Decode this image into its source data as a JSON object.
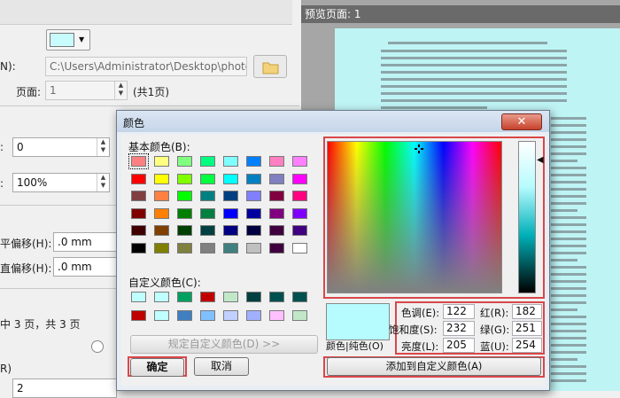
{
  "background": {
    "fields": [
      {
        "label": "N):",
        "value": "C:\\Users\\Administrator\\Desktop\\photo"
      },
      {
        "label": "页面:",
        "value": "1",
        "suffix": "(共1页)"
      },
      {
        "label": ":",
        "value": "0"
      },
      {
        "label": ":",
        "value": "100%"
      },
      {
        "label": "平偏移(H):",
        "value": ".0 mm"
      },
      {
        "label": "直偏移(H):",
        "value": ".0 mm"
      },
      {
        "label": "R)",
        "value": "2"
      }
    ],
    "page_status": "中 3 页，共 3 页",
    "swatch_color": "#c8fbfd"
  },
  "preview": {
    "title": "预览页面: 1",
    "bg_color": "#bff4f5"
  },
  "dialog": {
    "title": "颜色",
    "close_label": "✕",
    "basic_colors_label": "基本颜色(B):",
    "custom_colors_label": "自定义颜色(C):",
    "define_custom_label": "规定自定义颜色(D) >>",
    "ok_label": "确定",
    "cancel_label": "取消",
    "color_solid_label": "颜色|纯色(O)",
    "add_custom_label": "添加到自定义颜色(A)",
    "basic_colors": [
      "#ff8080",
      "#ffff80",
      "#80ff80",
      "#00ff80",
      "#80ffff",
      "#0080ff",
      "#ff80c0",
      "#ff80ff",
      "#ff0000",
      "#ffff00",
      "#80ff00",
      "#00ff40",
      "#00ffff",
      "#0080c0",
      "#8080c0",
      "#ff00ff",
      "#804040",
      "#ff8040",
      "#00ff00",
      "#008080",
      "#004080",
      "#8080ff",
      "#800040",
      "#ff0080",
      "#800000",
      "#ff8000",
      "#008000",
      "#008040",
      "#0000ff",
      "#0000a0",
      "#800080",
      "#8000ff",
      "#400000",
      "#804000",
      "#004000",
      "#004040",
      "#000080",
      "#000040",
      "#400040",
      "#400080",
      "#000000",
      "#808000",
      "#808040",
      "#808080",
      "#408080",
      "#c0c0c0",
      "#400040",
      "#ffffff"
    ],
    "custom_colors": [
      "#c0ffff",
      "#c0ffff",
      "#00a060",
      "#c00000",
      "#c0e8c8",
      "#004040",
      "#005050",
      "#005050",
      "#c00000",
      "#c0ffff",
      "#4080c0",
      "#80c0ff",
      "#c0d0ff",
      "#a0b0ff",
      "#ffc0ff",
      "#c0e8c8"
    ],
    "selected_color": "#b6fbfe",
    "hsl": [
      {
        "label": "色调(E):",
        "value": "122"
      },
      {
        "label": "饱和度(S):",
        "value": "232"
      },
      {
        "label": "亮度(L):",
        "value": "205"
      }
    ],
    "rgb": [
      {
        "label": "红(R):",
        "value": "182"
      },
      {
        "label": "绿(G):",
        "value": "251"
      },
      {
        "label": "蓝(U):",
        "value": "254"
      }
    ]
  }
}
